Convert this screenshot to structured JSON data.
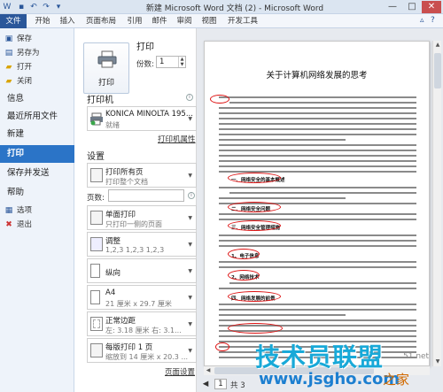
{
  "window": {
    "title": "新建 Microsoft Word 文档 (2) - Microsoft Word",
    "controls": {
      "minimize": "—",
      "maximize": "□",
      "close": "✕"
    }
  },
  "ribbon": {
    "tabs": [
      "文件",
      "开始",
      "插入",
      "页面布局",
      "引用",
      "邮件",
      "审阅",
      "视图",
      "开发工具"
    ]
  },
  "nav": {
    "small_items": [
      {
        "label": "保存",
        "icon": "save-icon"
      },
      {
        "label": "另存为",
        "icon": "save-as-icon"
      },
      {
        "label": "打开",
        "icon": "open-folder-icon"
      },
      {
        "label": "关闭",
        "icon": "close-document-icon"
      }
    ],
    "big_items": [
      "信息",
      "最近所用文件",
      "新建",
      "打印",
      "保存并发送",
      "帮助"
    ],
    "active": "打印",
    "bottom_items": [
      {
        "label": "选项",
        "icon": "options-icon"
      },
      {
        "label": "退出",
        "icon": "exit-icon"
      }
    ]
  },
  "print": {
    "section_title": "打印",
    "button_label": "打印",
    "copies_label": "份数:",
    "copies_value": "1",
    "printer_section": "打印机",
    "printer_name": "KONICA MINOLTA 195...",
    "printer_status": "就绪",
    "printer_props_link": "打印机属性",
    "settings_section": "设置",
    "pages_label": "页数:",
    "pages_value": "",
    "options": [
      {
        "title": "打印所有页",
        "subtitle": "打印整个文档"
      },
      {
        "title": "单面打印",
        "subtitle": "只打印一侧的页面"
      },
      {
        "title": "调整",
        "subtitle": "1,2,3    1,2,3    1,2,3"
      },
      {
        "title": "纵向",
        "subtitle": ""
      },
      {
        "title": "A4",
        "subtitle": "21 厘米 x 29.7 厘米"
      },
      {
        "title": "正常边距",
        "subtitle": "左: 3.18 厘米    右: 3.1..."
      },
      {
        "title": "每版打印 1 页",
        "subtitle": "缩放到 14 厘米 x 20.3 ..."
      }
    ],
    "page_setup_link": "页面设置"
  },
  "preview": {
    "doc_title": "关于计算机网络发展的思考",
    "headings": [
      "一、网络安全的基本概述",
      "二、网络安全问题",
      "三、网络安全管理措施",
      "四、网络发展的前景",
      "1、电子信息",
      "2、网络技术"
    ],
    "page_current": "1",
    "page_total_text": "共 3"
  },
  "watermark": {
    "main": "技术员联盟",
    "url": "www.jsgho.com",
    "side": "之家",
    "small": "51.net"
  },
  "colors": {
    "file_tab": "#2b579a",
    "nav_active": "#2b74c7",
    "annotation_red": "#d11111",
    "watermark_blue": "#18a9d8"
  }
}
